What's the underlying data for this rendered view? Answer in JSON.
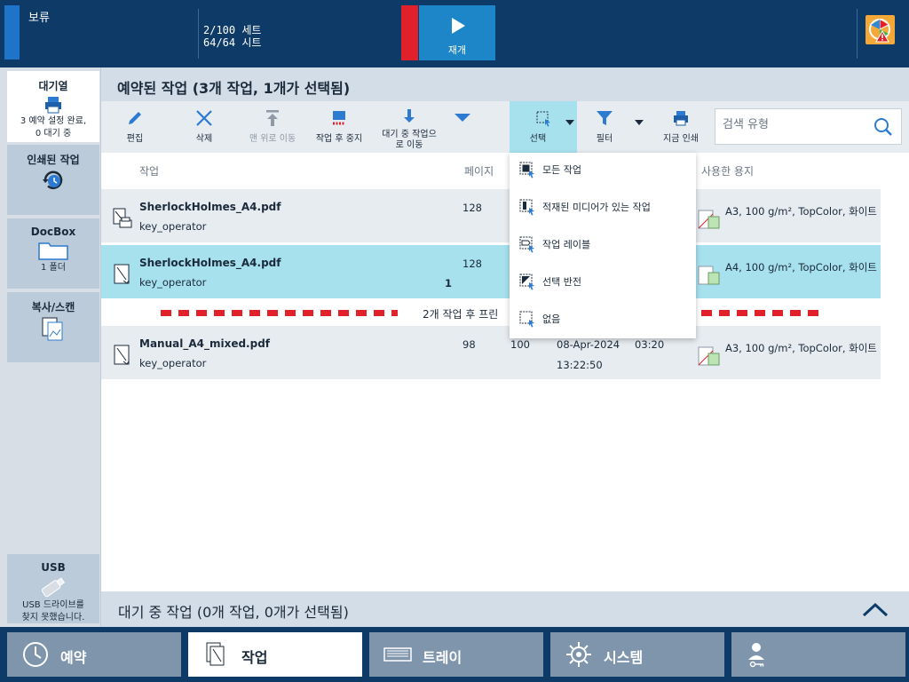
{
  "top": {
    "status_label": "보류",
    "sets": "2/100 세트",
    "sheets": "64/64 시트",
    "resume_label": "재개",
    "alert_icon": "color-wheel-warning-icon"
  },
  "sidebar": {
    "items": [
      {
        "title": "대기열",
        "sub1": "3 예약 설정 완료,",
        "sub2": "0 대기 중",
        "icon": "printer-icon"
      },
      {
        "title": "인쇄된 작업",
        "sub1": "",
        "sub2": "",
        "icon": "printed-history-icon"
      },
      {
        "title": "DocBox",
        "sub1": "1 폴더",
        "sub2": "",
        "icon": "folder-icon"
      },
      {
        "title": "복사/스캔",
        "sub1": "",
        "sub2": "",
        "icon": "copy-scan-icon"
      }
    ],
    "usb": {
      "title": "USB",
      "sub1": "USB 드라이브를",
      "sub2": "찾지 못했습니다."
    }
  },
  "content": {
    "title": "예약된 작업 (3개 작업, 1개가 선택됨)"
  },
  "toolbar": {
    "edit": "편집",
    "delete": "삭제",
    "move_top": "맨 위로 이동",
    "stop_after": "작업 후 중지",
    "move_waiting": "대기 중 작업으로 이동",
    "select": "선택",
    "filter": "필터",
    "print_now": "지금 인쇄",
    "search_placeholder": "검색 유형"
  },
  "columns": {
    "job": "작업",
    "pages": "페이지",
    "media": "사용한 용지"
  },
  "rows": [
    {
      "name": "SherlockHolmes_A4.pdf",
      "owner": "key_operator",
      "pages": "128",
      "copies": "",
      "date": "",
      "time": "",
      "duration": "",
      "qty": "",
      "media": "A3, 100 g/m², TopColor, 화이트",
      "selected": false
    },
    {
      "name": "SherlockHolmes_A4.pdf",
      "owner": "key_operator",
      "pages": "128",
      "copies": "",
      "date": "",
      "time": "",
      "duration": "",
      "qty": "1",
      "media": "A4, 100 g/m², TopColor, 화이트",
      "selected": true
    },
    {
      "name": "Manual_A4_mixed.pdf",
      "owner": "key_operator",
      "pages": "98",
      "copies": "100",
      "date": "08-Apr-2024",
      "time": "13:22:50",
      "duration": "03:20",
      "qty": "",
      "media": "A3, 100 g/m², TopColor, 화이트",
      "selected": false
    }
  ],
  "stop_line": {
    "text": "2개 작업 후 프린"
  },
  "select_menu": {
    "items": [
      "모든 작업",
      "적재된 미디어가 있는 작업",
      "작업 레이블",
      "선택 반전",
      "없음"
    ]
  },
  "waiting": {
    "title": "대기 중 작업 (0개 작업, 0개가 선택됨)"
  },
  "nav": {
    "tabs": [
      {
        "label": "예약",
        "icon": "clock-icon",
        "active": false
      },
      {
        "label": "작업",
        "icon": "jobs-icon",
        "active": true
      },
      {
        "label": "트레이",
        "icon": "tray-icon",
        "active": false
      },
      {
        "label": "시스템",
        "icon": "gear-icon",
        "active": false
      },
      {
        "label": "",
        "icon": "user-key-icon",
        "active": false
      }
    ]
  },
  "colors": {
    "nav_dark": "#0d3a66",
    "accent_blue": "#1d86c8",
    "selected_row": "#a7e1ee",
    "alert_red": "#e0202a",
    "alert_orange": "#f3a838"
  }
}
